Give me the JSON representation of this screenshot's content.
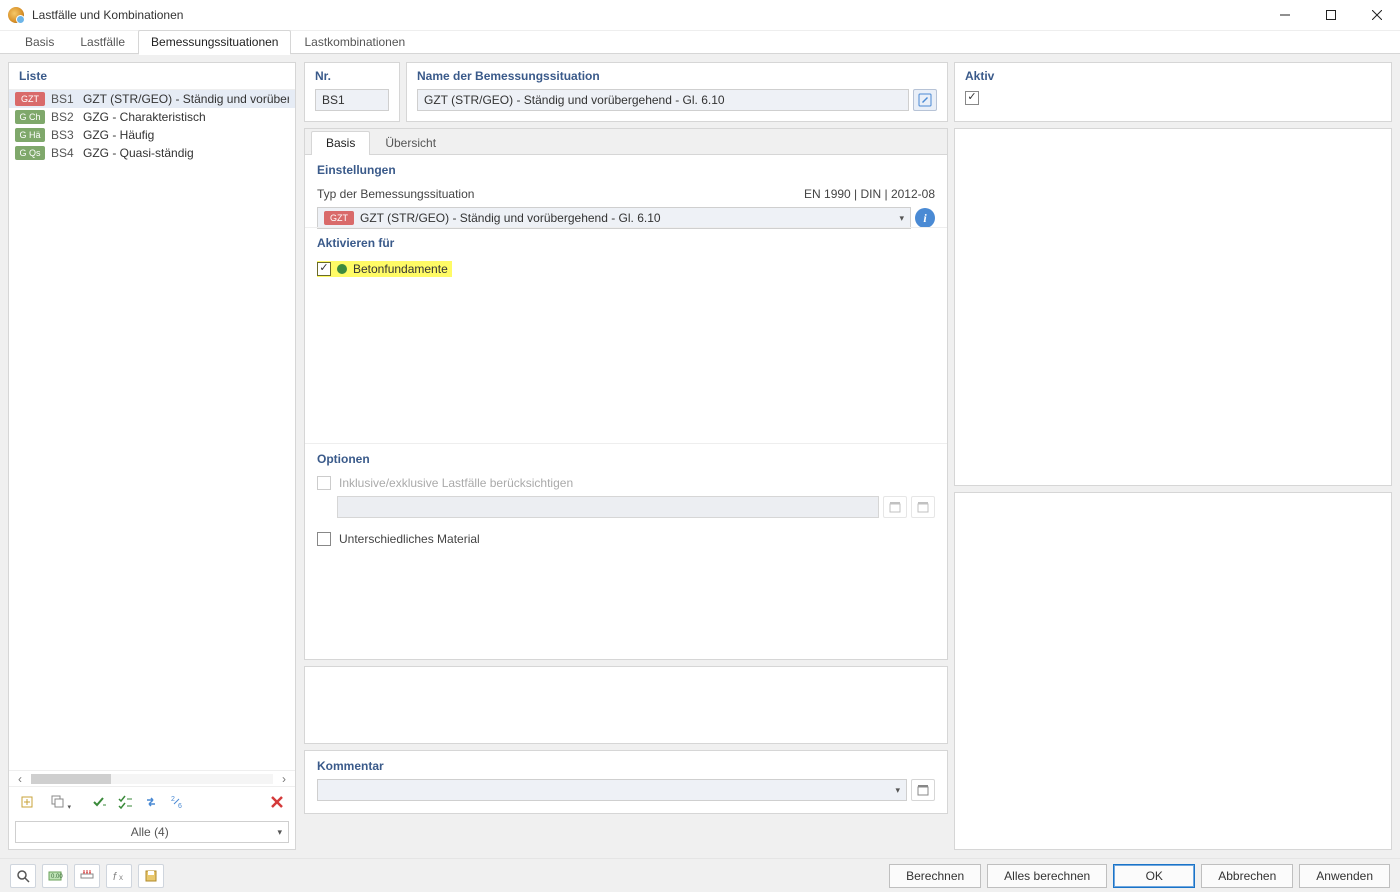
{
  "window": {
    "title": "Lastfälle und Kombinationen"
  },
  "topTabs": {
    "items": [
      "Basis",
      "Lastfälle",
      "Bemessungssituationen",
      "Lastkombinationen"
    ],
    "activeIndex": 2
  },
  "list": {
    "header": "Liste",
    "rows": [
      {
        "badge": "GZT",
        "badgeClass": "red",
        "code": "BS1",
        "label": "GZT (STR/GEO) - Ständig und vorübergehenc",
        "selected": true
      },
      {
        "badge": "G Ch",
        "badgeClass": "green",
        "code": "BS2",
        "label": "GZG - Charakteristisch",
        "selected": false
      },
      {
        "badge": "G Hä",
        "badgeClass": "green",
        "code": "BS3",
        "label": "GZG - Häufig",
        "selected": false
      },
      {
        "badge": "G Qs",
        "badgeClass": "green",
        "code": "BS4",
        "label": "GZG - Quasi-ständig",
        "selected": false
      }
    ],
    "filter": "Alle (4)"
  },
  "header": {
    "nrTitle": "Nr.",
    "nrValue": "BS1",
    "nameTitle": "Name der Bemessungssituation",
    "nameValue": "GZT (STR/GEO) - Ständig und vorübergehend - Gl. 6.10",
    "aktivTitle": "Aktiv"
  },
  "innerTabs": {
    "items": [
      "Basis",
      "Übersicht"
    ],
    "activeIndex": 0
  },
  "settings": {
    "title": "Einstellungen",
    "typeLabel": "Typ der Bemessungssituation",
    "standard": "EN 1990 | DIN | 2012-08",
    "typeBadge": "GZT",
    "typeValue": "GZT (STR/GEO) - Ständig und vorübergehend - Gl. 6.10"
  },
  "activate": {
    "title": "Aktivieren für",
    "item": "Betonfundamente"
  },
  "options": {
    "title": "Optionen",
    "inclusive": "Inklusive/exklusive Lastfälle berücksichtigen",
    "material": "Unterschiedliches Material"
  },
  "comment": {
    "title": "Kommentar"
  },
  "footer": {
    "berechnen": "Berechnen",
    "alles": "Alles berechnen",
    "ok": "OK",
    "abbrechen": "Abbrechen",
    "anwenden": "Anwenden"
  }
}
